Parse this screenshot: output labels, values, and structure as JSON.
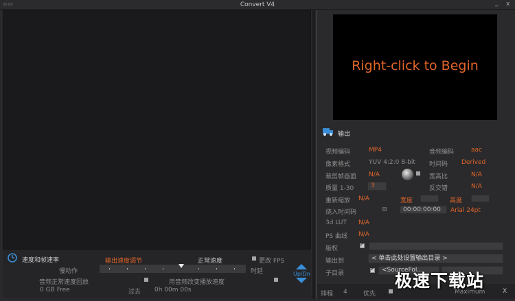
{
  "titlebar": {
    "version_text": "32-bit",
    "title": "Convert V4",
    "minimize_glyph": "_",
    "close_glyph": "x"
  },
  "preview": {
    "hint": "Right-click to Begin"
  },
  "output": {
    "heading": "输出",
    "video_codec_label": "视频编码",
    "video_codec_value": "MP4",
    "audio_codec_label": "音频编码",
    "audio_codec_value": "aac",
    "pixel_format_label": "像素格式",
    "pixel_format_value": "YUV 4:2:0 8-bit",
    "timecode_label": "时间码",
    "timecode_value": "Derived",
    "crop_label": "裁剪帧画面",
    "crop_value": "N/A",
    "aspect_label": "宽高比",
    "aspect_value": "N/A",
    "quality_label": "质量 1-30",
    "quality_value": "3",
    "deinterlace_label": "反交错",
    "deinterlace_value": "N/A",
    "rescale_label": "重新缩放",
    "rescale_value": "N/A",
    "width_label": "宽度",
    "height_label": "高度",
    "burn_tc_label": "烧入时间码",
    "burn_tc_value": "00:00:00:00",
    "burn_tc_font": "Arial 24pt",
    "lut_label": "3d LUT",
    "lut_value": "N/A",
    "ps_curve_label": "PS 曲线",
    "ps_curve_value": "N/A",
    "copyright_label": "版权",
    "output_to_label": "输出到",
    "output_to_value": "< 单击此处设置输出目录 >",
    "subdir_label": "子目录",
    "subdir_value": "<SourceFol..."
  },
  "status": {
    "queue_label": "排程",
    "queue_count": "4",
    "priority_label": "优先",
    "priority_value": "Maximum",
    "close_glyph": "X"
  },
  "speed": {
    "heading": "速度和帧速率",
    "adjust_label": "输出速度调节",
    "normal_label": "正常速度",
    "slow_label": "慢动作",
    "fps_label": "更改 FPS",
    "delay_label": "时延",
    "audio_normal_label": "音频正常速度回放",
    "audio_change_label": "用音频改变播放速度",
    "free_space": "0 GB Free",
    "elapsed_label": "过去",
    "elapsed_value": "0h 00m 00s",
    "updn_label": "Up/Dn"
  },
  "watermark": "极速下载站",
  "colors": {
    "accent": "#e0652a",
    "blue": "#3a8ed8",
    "panel": "#1a1a1c"
  }
}
